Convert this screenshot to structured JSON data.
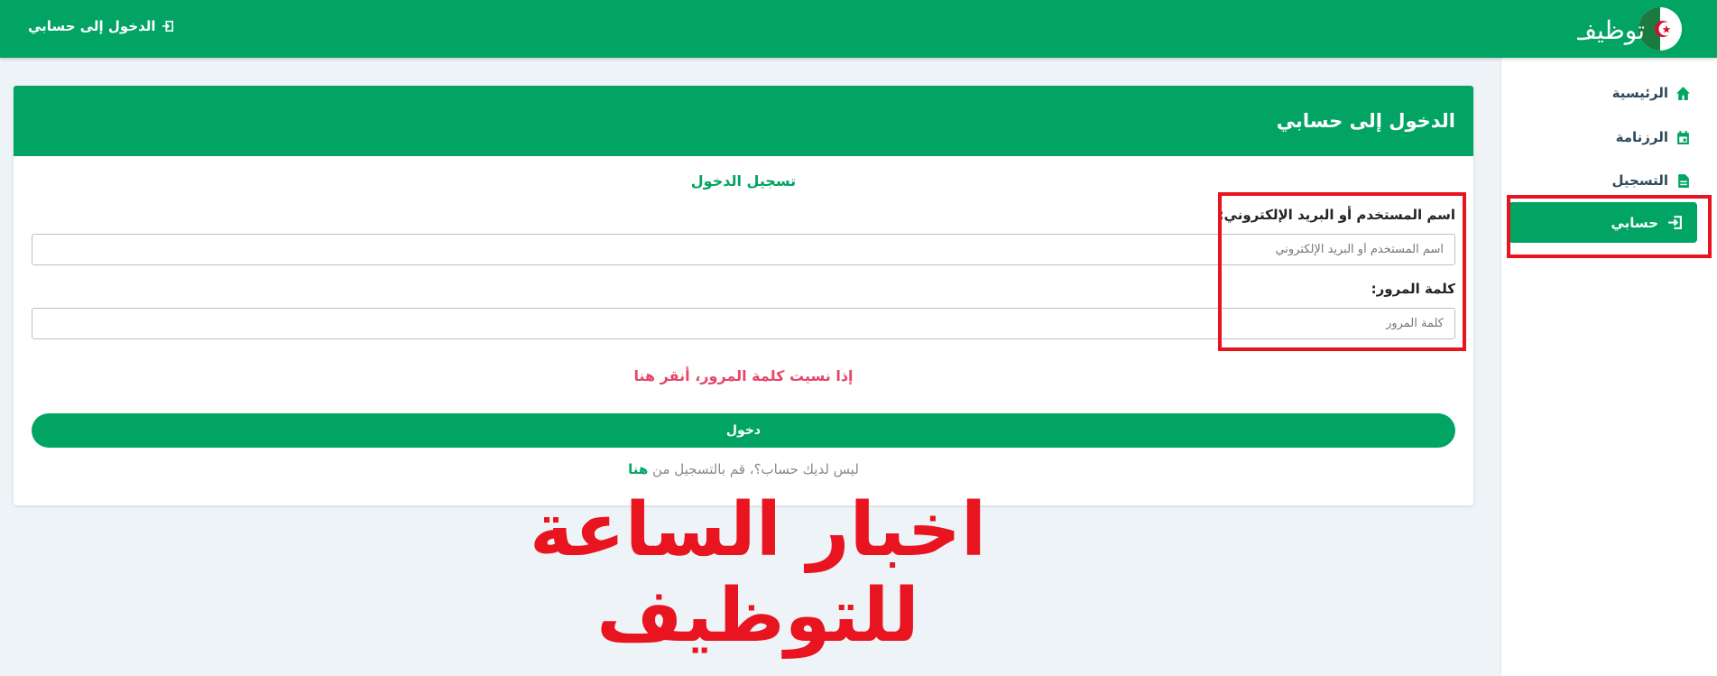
{
  "header": {
    "logo_text": "توظيف",
    "login_link": "الدخول إلى حسابي"
  },
  "sidebar": {
    "items": [
      {
        "label": "الرئيسية",
        "icon": "home-icon"
      },
      {
        "label": "الرزنامة",
        "icon": "calendar-icon"
      },
      {
        "label": "التسجيل",
        "icon": "document-icon"
      }
    ],
    "active": {
      "label": "حسابي",
      "icon": "login-icon"
    }
  },
  "card": {
    "header_title": "الدخول إلى حسابي",
    "form_title": "تسجيل الدخول",
    "username_label": "اسم المستخدم أو البريد الإلكتروني:",
    "username_placeholder": "اسم المستخدم أو البريد الإلكتروني",
    "password_label": "كلمة المرور:",
    "password_placeholder": "كلمة المرور",
    "forgot_text": "إذا نسيت كلمة المرور، أنقر هنا",
    "submit_label": "دخول",
    "register_prefix": "ليس لديك حساب؟، قم بالتسجيل من",
    "register_link": "هنا"
  },
  "watermark": "اخبار الساعة للتوظيف",
  "colors": {
    "brand": "#02a463",
    "highlight": "#e8141f",
    "forgot": "#e74668",
    "background": "#edf3f6"
  }
}
